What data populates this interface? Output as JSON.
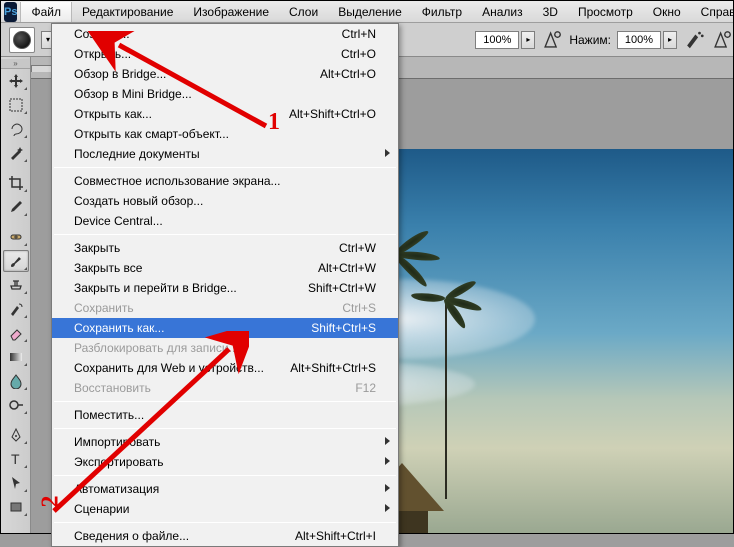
{
  "app": {
    "logo": "Ps"
  },
  "menubar": {
    "items": [
      "Файл",
      "Редактирование",
      "Изображение",
      "Слои",
      "Выделение",
      "Фильтр",
      "Анализ",
      "3D",
      "Просмотр",
      "Окно",
      "Справк"
    ],
    "active_index": 0
  },
  "optionsbar": {
    "flow_label": "",
    "opacity_value": "100%",
    "press_label": "Нажим:",
    "press_value": "100%"
  },
  "tab": {
    "label": "",
    "close": "×"
  },
  "dropdown": {
    "groups": [
      [
        {
          "label": "Создать...",
          "shortcut": "Ctrl+N",
          "disabled": false
        },
        {
          "label": "Открыть...",
          "shortcut": "Ctrl+O",
          "disabled": false
        },
        {
          "label": "Обзор в Bridge...",
          "shortcut": "Alt+Ctrl+O",
          "disabled": false
        },
        {
          "label": "Обзор в Mini Bridge...",
          "shortcut": "",
          "disabled": false
        },
        {
          "label": "Открыть как...",
          "shortcut": "Alt+Shift+Ctrl+O",
          "disabled": false
        },
        {
          "label": "Открыть как смарт-объект...",
          "shortcut": "",
          "disabled": false
        },
        {
          "label": "Последние документы",
          "shortcut": "",
          "disabled": false,
          "submenu": true
        }
      ],
      [
        {
          "label": "Совместное использование экрана...",
          "shortcut": "",
          "disabled": false
        },
        {
          "label": "Создать новый обзор...",
          "shortcut": "",
          "disabled": false
        },
        {
          "label": "Device Central...",
          "shortcut": "",
          "disabled": false
        }
      ],
      [
        {
          "label": "Закрыть",
          "shortcut": "Ctrl+W",
          "disabled": false
        },
        {
          "label": "Закрыть все",
          "shortcut": "Alt+Ctrl+W",
          "disabled": false
        },
        {
          "label": "Закрыть и перейти в Bridge...",
          "shortcut": "Shift+Ctrl+W",
          "disabled": false
        },
        {
          "label": "Сохранить",
          "shortcut": "Ctrl+S",
          "disabled": true
        },
        {
          "label": "Сохранить как...",
          "shortcut": "Shift+Ctrl+S",
          "disabled": false,
          "highlight": true
        },
        {
          "label": "Разблокировать для записи...",
          "shortcut": "",
          "disabled": true
        },
        {
          "label": "Сохранить для Web и устройств...",
          "shortcut": "Alt+Shift+Ctrl+S",
          "disabled": false
        },
        {
          "label": "Восстановить",
          "shortcut": "F12",
          "disabled": true
        }
      ],
      [
        {
          "label": "Поместить...",
          "shortcut": "",
          "disabled": false
        }
      ],
      [
        {
          "label": "Импортировать",
          "shortcut": "",
          "disabled": false,
          "submenu": true
        },
        {
          "label": "Экспортировать",
          "shortcut": "",
          "disabled": false,
          "submenu": true
        }
      ],
      [
        {
          "label": "Автоматизация",
          "shortcut": "",
          "disabled": false,
          "submenu": true
        },
        {
          "label": "Сценарии",
          "shortcut": "",
          "disabled": false,
          "submenu": true
        }
      ],
      [
        {
          "label": "Сведения о файле...",
          "shortcut": "Alt+Shift+Ctrl+I",
          "disabled": false
        }
      ]
    ]
  },
  "annotation": {
    "num1": "1",
    "num2": "2"
  }
}
